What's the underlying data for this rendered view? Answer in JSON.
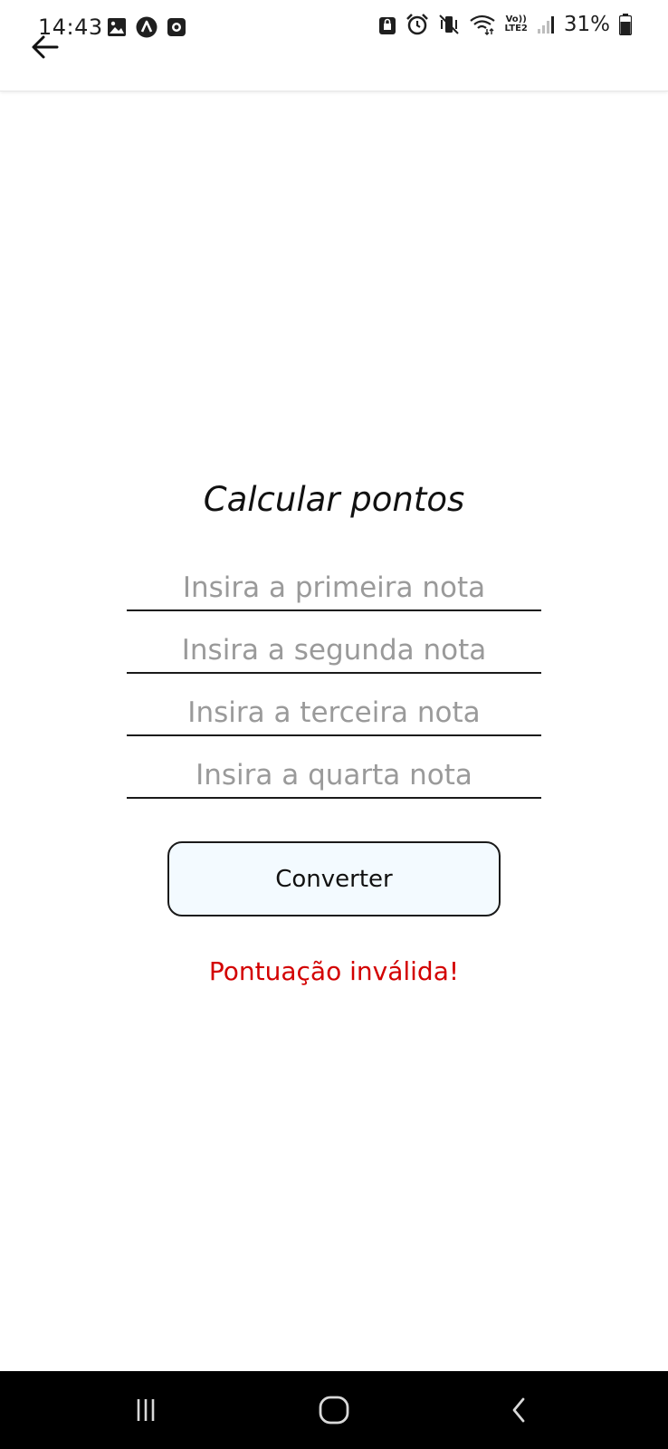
{
  "status_bar": {
    "time": "14:43",
    "battery": "31%",
    "network_label_top": "Vo))",
    "network_label_bottom": "LTE2",
    "left_icons": [
      "gallery-icon",
      "a-circle-icon",
      "record-icon"
    ],
    "right_icons": [
      "lock-badge-icon",
      "alarm-icon",
      "vibrate-mute-icon",
      "wifi-icon",
      "signal-icon",
      "battery-icon"
    ]
  },
  "app_bar": {
    "back_icon": "arrow-left-icon"
  },
  "main": {
    "title": "Calcular pontos",
    "fields": [
      {
        "placeholder": "Insira a primeira nota",
        "value": ""
      },
      {
        "placeholder": "Insira a segunda nota",
        "value": ""
      },
      {
        "placeholder": "Insira a terceira nota",
        "value": ""
      },
      {
        "placeholder": "Insira a quarta nota",
        "value": ""
      }
    ],
    "convert_label": "Converter",
    "result_message": "Pontuação inválida!",
    "result_color": "#d30000"
  },
  "nav_bar": {
    "icons": [
      "recents-icon",
      "home-icon",
      "back-nav-icon"
    ]
  }
}
